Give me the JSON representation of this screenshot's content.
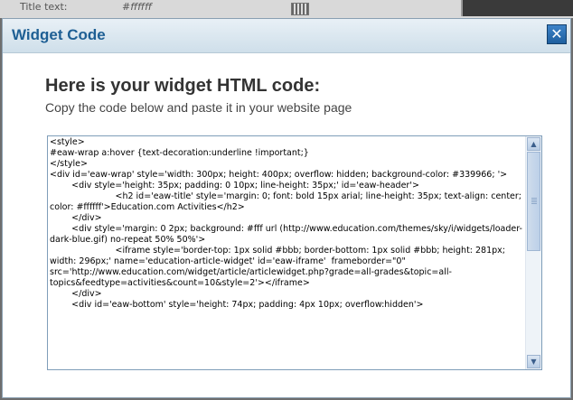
{
  "background": {
    "label": "Title text:",
    "value": "#ffffff"
  },
  "dialog": {
    "title": "Widget Code",
    "close_symbol": "✕",
    "heading": "Here is your widget HTML code:",
    "subheading": "Copy the code below and paste it in your website page",
    "code": "<style>\n#eaw-wrap a:hover {text-decoration:underline !important;}\n</style>\n<div id='eaw-wrap' style='width: 300px; height: 400px; overflow: hidden; background-color: #339966; '>\n        <div style='height: 35px; padding: 0 10px; line-height: 35px;' id='eaw-header'>\n                        <h2 id='eaw-title' style='margin: 0; font: bold 15px arial; line-height: 35px; text-align: center; color: #ffffff'>Education.com Activities</h2>\n        </div>\n        <div style='margin: 0 2px; background: #fff url (http://www.education.com/themes/sky/i/widgets/loader-dark-blue.gif) no-repeat 50% 50%'>\n                        <iframe style='border-top: 1px solid #bbb; border-bottom: 1px solid #bbb; height: 281px; width: 296px;' name='education-article-widget' id='eaw-iframe'  frameborder=\"0\" src='http://www.education.com/widget/article/articlewidget.php?grade=all-grades&topic=all-topics&feedtype=activities&count=10&style=2'></iframe>\n        </div>\n        <div id='eaw-bottom' style='height: 74px; padding: 4px 10px; overflow:hidden'>"
  }
}
